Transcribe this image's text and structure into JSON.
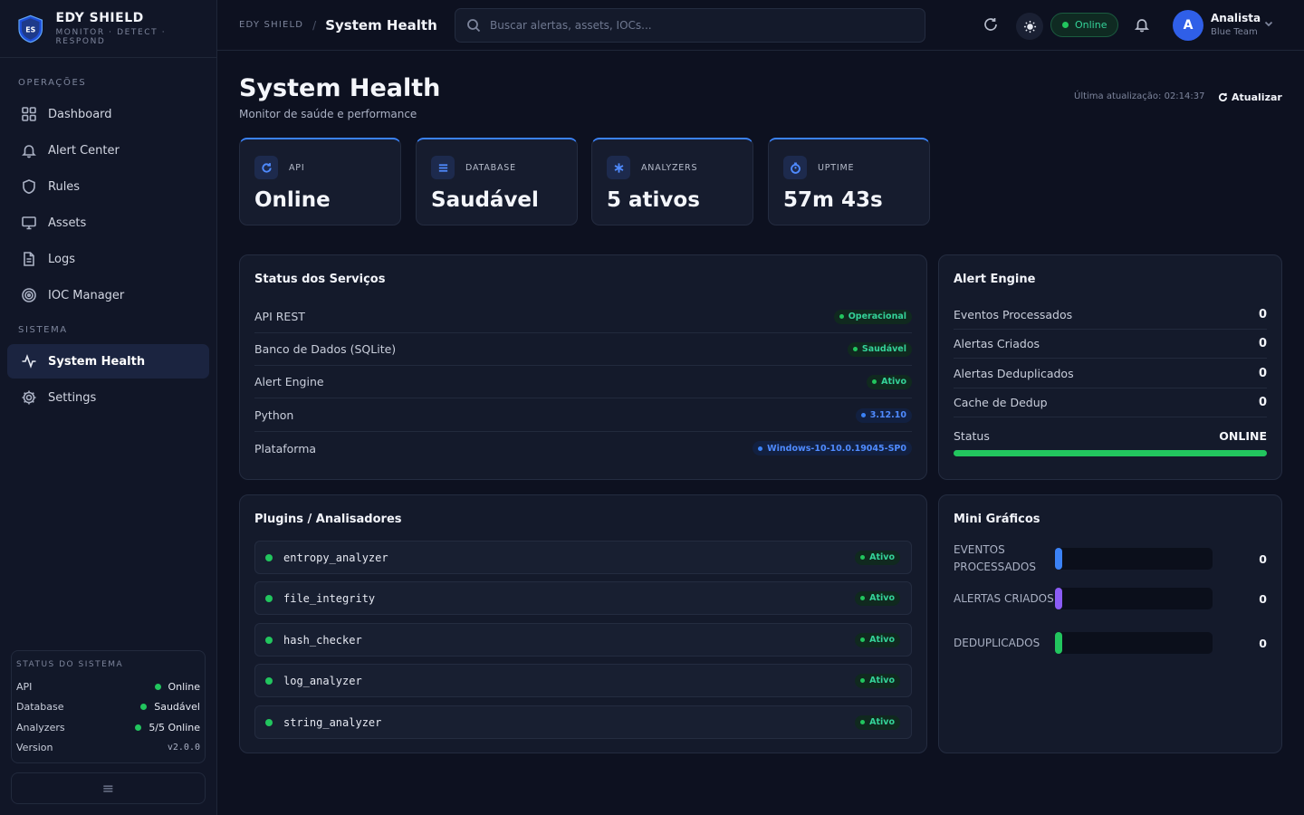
{
  "brand": {
    "name": "EDY SHIELD",
    "tagline": "MONITOR · DETECT · RESPOND",
    "logo_text": "ES"
  },
  "sidebar": {
    "section_ops": "OPERAÇÕES",
    "section_sys": "SISTEMA",
    "ops_items": [
      {
        "label": "Dashboard",
        "icon": "grid-icon"
      },
      {
        "label": "Alert Center",
        "icon": "bell-icon"
      },
      {
        "label": "Rules",
        "icon": "shield-icon"
      },
      {
        "label": "Assets",
        "icon": "monitor-icon"
      },
      {
        "label": "Logs",
        "icon": "file-icon"
      },
      {
        "label": "IOC Manager",
        "icon": "target-icon"
      }
    ],
    "sys_items": [
      {
        "label": "System Health",
        "icon": "activity-icon",
        "active": true
      },
      {
        "label": "Settings",
        "icon": "gear-icon"
      }
    ],
    "status": {
      "title": "STATUS DO SISTEMA",
      "rows": [
        {
          "label": "API",
          "value": "Online"
        },
        {
          "label": "Database",
          "value": "Saudável"
        },
        {
          "label": "Analyzers",
          "value": "5/5 Online"
        },
        {
          "label": "Version",
          "value": "v2.0.0"
        }
      ]
    },
    "collapse_icon": "≡"
  },
  "header": {
    "breadcrumb_root": "EDY SHIELD",
    "breadcrumb_sep": "/",
    "breadcrumb_current": "System Health",
    "search_placeholder": "Buscar alertas, assets, IOCs...",
    "status_pill": "Online",
    "user": {
      "initial": "A",
      "name": "Analista",
      "role": "Blue Team"
    }
  },
  "page": {
    "title": "System Health",
    "subtitle": "Monitor de saúde e performance",
    "last_update": "Última atualização: 02:14:37",
    "refresh_label": "Atualizar"
  },
  "kpis": [
    {
      "label": "API",
      "value": "Online",
      "icon": "refresh-icon"
    },
    {
      "label": "DATABASE",
      "value": "Saudável",
      "icon": "list-icon"
    },
    {
      "label": "ANALYZERS",
      "value": "5 ativos",
      "icon": "asterisk-icon"
    },
    {
      "label": "UPTIME",
      "value": "57m 43s",
      "icon": "timer-icon"
    }
  ],
  "services": {
    "title": "Status dos Serviços",
    "rows": [
      {
        "name": "API REST",
        "status": "Operacional",
        "color": "green"
      },
      {
        "name": "Banco de Dados (SQLite)",
        "status": "Saudável",
        "color": "green"
      },
      {
        "name": "Alert Engine",
        "status": "Ativo",
        "color": "green"
      },
      {
        "name": "Python",
        "status": "3.12.10",
        "color": "blue"
      },
      {
        "name": "Plataforma",
        "status": "Windows-10-10.0.19045-SP0",
        "color": "blue"
      }
    ]
  },
  "alert_engine": {
    "title": "Alert Engine",
    "rows": [
      {
        "label": "Eventos Processados",
        "value": "0"
      },
      {
        "label": "Alertas Criados",
        "value": "0"
      },
      {
        "label": "Alertas Deduplicados",
        "value": "0"
      },
      {
        "label": "Cache de Dedup",
        "value": "0"
      }
    ],
    "status_label": "Status",
    "status_value": "ONLINE",
    "status_fill": 1.0
  },
  "plugins": {
    "title": "Plugins / Analisadores",
    "rows": [
      {
        "name": "entropy_analyzer",
        "status": "Ativo"
      },
      {
        "name": "file_integrity",
        "status": "Ativo"
      },
      {
        "name": "hash_checker",
        "status": "Ativo"
      },
      {
        "name": "log_analyzer",
        "status": "Ativo"
      },
      {
        "name": "string_analyzer",
        "status": "Ativo"
      }
    ]
  },
  "mini_charts": {
    "title": "Mini Gráficos",
    "rows": [
      {
        "label": "EVENTOS PROCESSADOS",
        "value": "0",
        "color": "#3b82f6"
      },
      {
        "label": "ALERTAS CRIADOS",
        "value": "0",
        "color": "#8b5cf6"
      },
      {
        "label": "DEDUPLICADOS",
        "value": "0",
        "color": "#22c55e"
      }
    ]
  }
}
